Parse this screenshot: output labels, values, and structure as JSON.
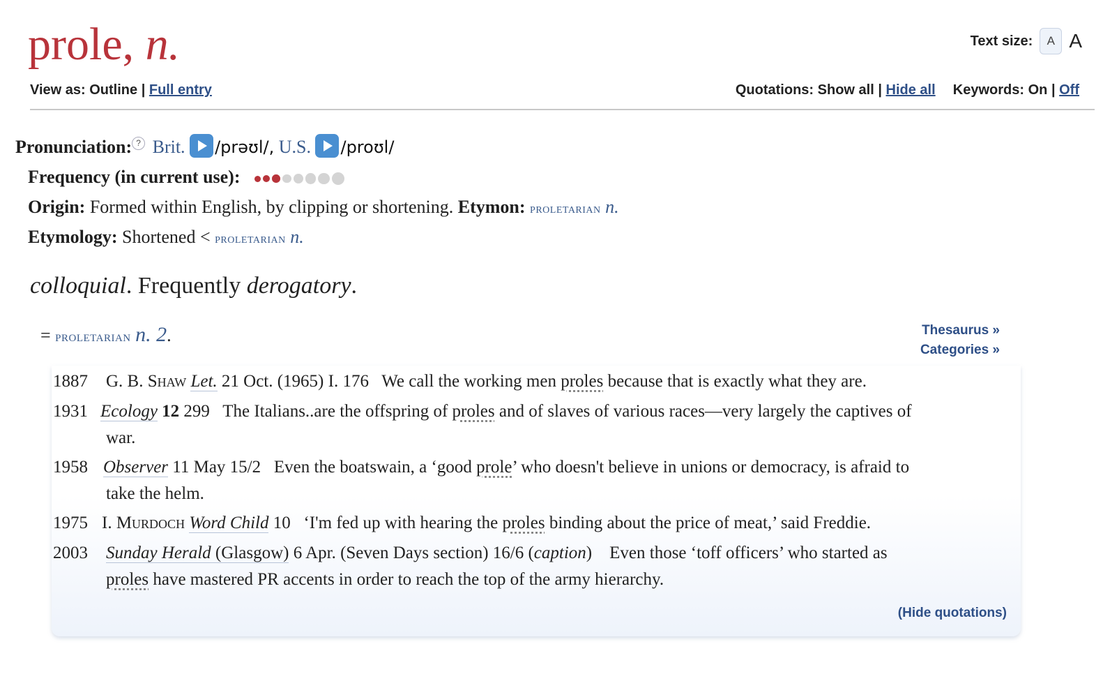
{
  "header": {
    "headword": "prole,",
    "pos": "n.",
    "view_as_label": "View as:",
    "view_outline": "Outline",
    "view_sep": "|",
    "view_full_entry": "Full entry",
    "text_size_label": "Text size:",
    "text_size_small": "A",
    "text_size_large": "A",
    "quotations_label": "Quotations:",
    "quotations_show_all": "Show all",
    "quotations_sep": "|",
    "quotations_hide_all": "Hide all",
    "keywords_label": "Keywords:",
    "keywords_on": "On",
    "keywords_sep": "|",
    "keywords_off": "Off"
  },
  "pronunciation": {
    "label": "Pronunciation:",
    "help": "?",
    "brit_label": "Brit.",
    "brit_ipa": "/prəʊl/,",
    "us_label": "U.S.",
    "us_ipa": "/proʊl/"
  },
  "frequency": {
    "label": "Frequency (in current use):",
    "level": 3,
    "max": 8,
    "active_color": "#b8333a",
    "inactive_color": "#d4d4d4"
  },
  "origin": {
    "label": "Origin:",
    "text": "Formed within English, by clipping or shortening.",
    "etymon_label": "Etymon:",
    "etymon_word": "proletarian",
    "etymon_pos": "n."
  },
  "etymology": {
    "label": "Etymology:",
    "text": "Shortened <",
    "word": "proletarian",
    "pos": "n."
  },
  "sense": {
    "label_italic_1": "colloquial",
    "label_mid": ". Frequently ",
    "label_italic_2": "derogatory",
    "label_end": ".",
    "equals": "=",
    "xref_word": "proletarian",
    "xref_pos": "n. 2",
    "xref_end": "."
  },
  "sidebar": {
    "thesaurus": "Thesaurus »",
    "categories": "Categories »"
  },
  "quotations": [
    {
      "year": "1887",
      "pre": "G. B. ",
      "author": "Shaw",
      "title": "Let.",
      "cite": " 21 Oct. (1965) I. 176",
      "text_before": "We call the working men ",
      "keyword": "proles",
      "text_after": " because that is exactly what they are."
    },
    {
      "year": "1931",
      "title": "Ecology",
      "vol": "12",
      "cite": " 299",
      "text_before": "The Italians..are the offspring of ",
      "keyword": "proles",
      "text_after": " and of slaves of various races—very largely the captives of",
      "cont": "war."
    },
    {
      "year": "1958",
      "title": "Observer",
      "cite": " 11 May 15/2",
      "text_before": "Even the boatswain, a ‘good ",
      "keyword": "prole",
      "text_after": "’ who doesn't believe in unions or democracy, is afraid to",
      "cont": "take the helm."
    },
    {
      "year": "1975",
      "pre": "I. ",
      "author": "Murdoch",
      "title": "Word Child",
      "cite": " 10",
      "text_before": "‘I'm fed up with hearing the ",
      "keyword": "proles",
      "text_after": " binding about the price of meat,’ said Freddie."
    },
    {
      "year": "2003",
      "title": "Sunday Herald",
      "title_extra": " (Glasgow)",
      "cite": " 6 Apr. (Seven Days section) 16/6 (",
      "cite_italic": "caption",
      "cite_end": ")",
      "text_before": "Even those ‘toff officers’ who started as",
      "keyword": "proles",
      "text_after": " have mastered PR accents in order to reach the top of the army hierarchy."
    }
  ],
  "hide_quotations": "(Hide quotations)"
}
